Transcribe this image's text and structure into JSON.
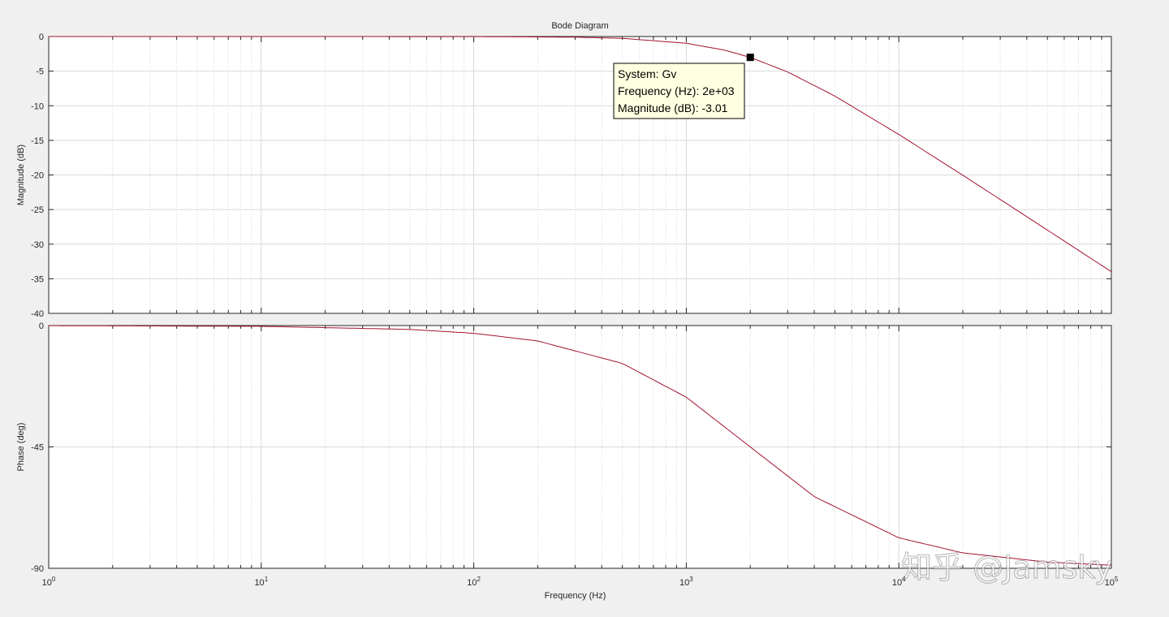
{
  "chart_data": {
    "type": "line",
    "title": "Bode Diagram",
    "xlabel": "Frequency  (Hz)",
    "x_scale": "log",
    "xlim": [
      1,
      100000
    ],
    "x_ticks": [
      {
        "base": "10",
        "exp": "0"
      },
      {
        "base": "10",
        "exp": "1"
      },
      {
        "base": "10",
        "exp": "2"
      },
      {
        "base": "10",
        "exp": "3"
      },
      {
        "base": "10",
        "exp": "4"
      },
      {
        "base": "10",
        "exp": "5"
      }
    ],
    "grid": true,
    "line_color": "#a2142f",
    "panels": [
      {
        "name": "magnitude",
        "ylabel": "Magnitude (dB)",
        "ylim": [
          -40,
          0
        ],
        "y_ticks": [
          "0",
          "-5",
          "-10",
          "-15",
          "-20",
          "-25",
          "-30",
          "-35",
          "-40"
        ],
        "series": [
          {
            "x": [
              1,
              10,
              100,
              300,
              500,
              1000,
              1500,
              2000,
              3000,
              5000,
              10000,
              20000,
              50000,
              100000
            ],
            "y": [
              0,
              0,
              -0.01,
              -0.09,
              -0.26,
              -0.97,
              -1.94,
              -3.01,
              -5.12,
              -8.6,
              -14.15,
              -20.04,
              -27.96,
              -33.98
            ]
          }
        ]
      },
      {
        "name": "phase",
        "ylabel": "Phase (deg)",
        "ylim": [
          -90,
          0
        ],
        "y_ticks": [
          "0",
          "-45",
          "-90"
        ],
        "series": [
          {
            "x": [
              1,
              10,
              50,
              100,
              200,
              500,
              1000,
              2000,
              4000,
              10000,
              20000,
              50000,
              100000
            ],
            "y": [
              -0.03,
              -0.29,
              -1.43,
              -2.86,
              -5.71,
              -14.04,
              -26.57,
              -45,
              -63.43,
              -78.69,
              -84.29,
              -87.71,
              -88.85
            ]
          }
        ]
      }
    ],
    "datatip": {
      "lines": [
        "System: Gv",
        "Frequency (Hz): 2e+03",
        "Magnitude (dB): -3.01"
      ],
      "x": 2000,
      "y": -3.01
    }
  },
  "watermark": "知乎 @Jamsky"
}
